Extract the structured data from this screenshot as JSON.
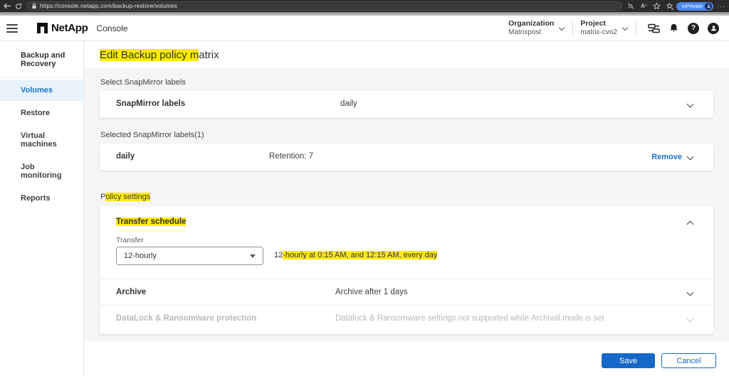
{
  "browser": {
    "url": "https://console.netapp.com/backup-restore/volumes",
    "inprivate_label": "InPrivate",
    "icons": [
      "back-arrow",
      "refresh",
      "lock",
      "read-aloud-off",
      "text-size",
      "favorites-star",
      "collections",
      "profile-avatar",
      "more-menu"
    ]
  },
  "header": {
    "logo_text": "NetApp",
    "product": "Console",
    "organization_label": "Organization",
    "organization_value": "Matrixpost",
    "project_label": "Project",
    "project_value": "matrix-cvo2",
    "icons": [
      "connector",
      "notifications-bell",
      "help",
      "account"
    ],
    "help_glyph": "?"
  },
  "sidebar": {
    "section": "Backup and Recovery",
    "items": [
      {
        "label": "Volumes",
        "active": true
      },
      {
        "label": "Restore",
        "active": false
      },
      {
        "label": "Virtual machines",
        "active": false
      },
      {
        "label": "Job monitoring",
        "active": false
      },
      {
        "label": "Reports",
        "active": false
      }
    ]
  },
  "main": {
    "title_highlight": "Edit Backup policy m",
    "title_rest": "atrix",
    "select_labels_heading": "Select SnapMirror labels",
    "snapmirror_row": {
      "label": "SnapMirror labels",
      "value": "daily"
    },
    "selected_heading": "Selected SnapMirror labels(1)",
    "selected_row": {
      "label": "daily",
      "retention": "Retention: 7",
      "remove_label": "Remove"
    },
    "policy_settings_pre": "P",
    "policy_settings_highlight": "olicy settings",
    "transfer_schedule_heading": "Transfer schedule",
    "transfer_label": "Transfer",
    "transfer_value": "12-hourly",
    "schedule_pre": "12",
    "schedule_highlight": "-hourly at 0:15 AM, and 12:15 AM, every day",
    "archive_row": {
      "label": "Archive",
      "value": "Archive after 1 days"
    },
    "datalock_row": {
      "label": "DataLock & Ransomware protection",
      "value": "Datalock & Ransomware settings not supported while Archival mode is set"
    }
  },
  "footer": {
    "save_label": "Save",
    "cancel_label": "Cancel"
  },
  "colors": {
    "accent_blue": "#1873c8",
    "save_button": "#1568c8",
    "highlight_yellow": "#fde910",
    "active_item_bg": "#e9f3fc",
    "content_bg": "#f5f5f5",
    "chrome_dark": "#2b2b2b",
    "inprivate_badge": "#4c86ee",
    "disabled_text": "#b9b9b9"
  }
}
